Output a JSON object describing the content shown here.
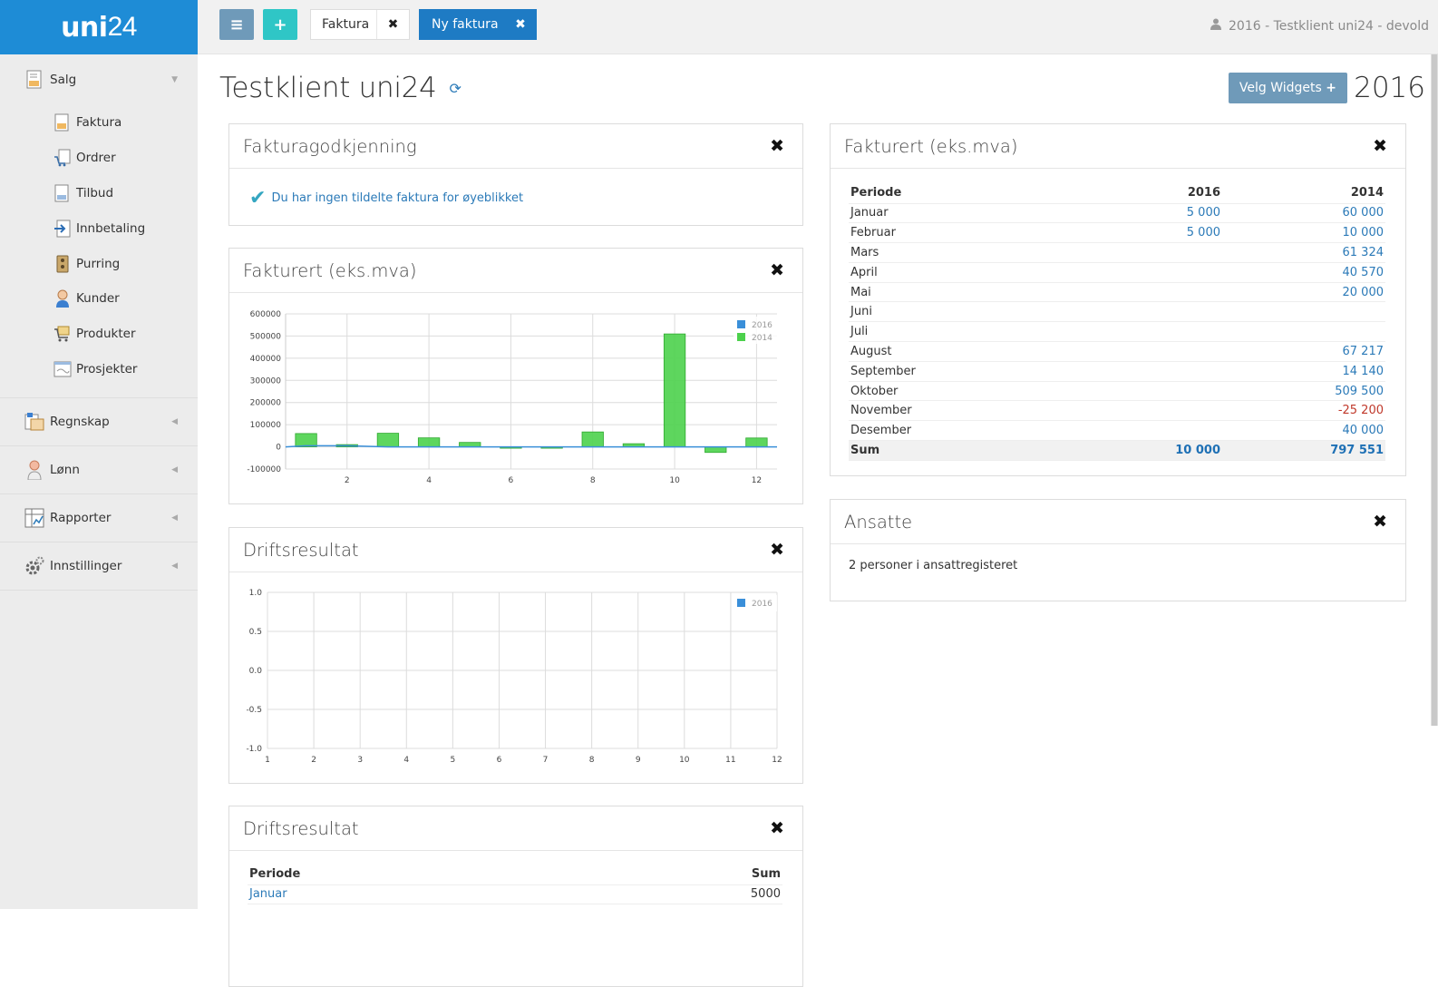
{
  "app": {
    "logo_bold": "uni",
    "logo_num": "24"
  },
  "sidebar": {
    "salg": {
      "label": "Salg"
    },
    "salg_items": [
      {
        "label": "Faktura",
        "icon": "invoice-icon"
      },
      {
        "label": "Ordrer",
        "icon": "order-cart-icon"
      },
      {
        "label": "Tilbud",
        "icon": "quote-icon"
      },
      {
        "label": "Innbetaling",
        "icon": "payment-icon"
      },
      {
        "label": "Purring",
        "icon": "reminder-icon"
      },
      {
        "label": "Kunder",
        "icon": "customer-icon"
      },
      {
        "label": "Produkter",
        "icon": "product-icon"
      },
      {
        "label": "Prosjekter",
        "icon": "project-icon"
      }
    ],
    "sections": [
      {
        "label": "Regnskap",
        "icon": "accounting-icon"
      },
      {
        "label": "Lønn",
        "icon": "salary-person-icon"
      },
      {
        "label": "Rapporter",
        "icon": "report-icon"
      },
      {
        "label": "Innstillinger",
        "icon": "gear-icon"
      }
    ]
  },
  "topbar": {
    "tab1_label": "Faktura",
    "tab2_label": "Ny faktura",
    "user_info": "2016 - Testklient uni24 - devold"
  },
  "main": {
    "title": "Testklient uni24",
    "velg_label": "Velg Widgets",
    "year": "2016"
  },
  "panels": {
    "approval": {
      "title": "Fakturagodkjenning",
      "message": "Du har ingen tildelte faktura for øyeblikket"
    },
    "chart1": {
      "title": "Fakturert (eks.mva)"
    },
    "chart2": {
      "title": "Driftsresultat"
    },
    "drift_table": {
      "title": "Driftsresultat",
      "col_period": "Periode",
      "col_sum": "Sum",
      "rows": [
        {
          "period": "Januar",
          "sum": "5000"
        }
      ]
    },
    "invoiced_table": {
      "title": "Fakturert (eks.mva)",
      "col_period": "Periode",
      "col_2016": "2016",
      "col_2014": "2014",
      "rows": [
        {
          "period": "Januar",
          "v2016": "5 000",
          "v2014": "60 000"
        },
        {
          "period": "Februar",
          "v2016": "5 000",
          "v2014": "10 000"
        },
        {
          "period": "Mars",
          "v2016": "",
          "v2014": "61 324"
        },
        {
          "period": "April",
          "v2016": "",
          "v2014": "40 570"
        },
        {
          "period": "Mai",
          "v2016": "",
          "v2014": "20 000"
        },
        {
          "period": "Juni",
          "v2016": "",
          "v2014": ""
        },
        {
          "period": "Juli",
          "v2016": "",
          "v2014": ""
        },
        {
          "period": "August",
          "v2016": "",
          "v2014": "67 217"
        },
        {
          "period": "September",
          "v2016": "",
          "v2014": "14 140"
        },
        {
          "period": "Oktober",
          "v2016": "",
          "v2014": "509 500"
        },
        {
          "period": "November",
          "v2016": "",
          "v2014": "-25 200"
        },
        {
          "period": "Desember",
          "v2016": "",
          "v2014": "40 000"
        }
      ],
      "sum_label": "Sum",
      "sum_2016": "10 000",
      "sum_2014": "797 551"
    },
    "employees": {
      "title": "Ansatte",
      "text": "2 personer i ansattregisteret"
    }
  },
  "colors": {
    "brand": "#1e8cd6",
    "series_2016": "#3a8fd9",
    "series_2014": "#4cd14c",
    "link": "#2b7ab8",
    "negative": "#c0392b"
  },
  "chart_data": [
    {
      "type": "bar",
      "title": "",
      "x": [
        1,
        2,
        3,
        4,
        5,
        6,
        7,
        8,
        9,
        10,
        11,
        12
      ],
      "xticks": [
        2,
        4,
        6,
        8,
        10,
        12
      ],
      "ylim": [
        -100000,
        600000
      ],
      "yticks": [
        -100000,
        0,
        100000,
        200000,
        300000,
        400000,
        500000,
        600000
      ],
      "legend_position": "top-right",
      "grid": true,
      "series": [
        {
          "name": "2016",
          "type": "line",
          "values": [
            5000,
            5000,
            0,
            0,
            0,
            0,
            0,
            0,
            0,
            0,
            0,
            0
          ]
        },
        {
          "name": "2014",
          "type": "bar",
          "values": [
            60000,
            10000,
            61324,
            40570,
            20000,
            0,
            0,
            67217,
            14140,
            509500,
            -25200,
            40000
          ]
        }
      ]
    },
    {
      "type": "line",
      "title": "",
      "x": [
        1,
        2,
        3,
        4,
        5,
        6,
        7,
        8,
        9,
        10,
        11,
        12
      ],
      "xticks": [
        1,
        2,
        3,
        4,
        5,
        6,
        7,
        8,
        9,
        10,
        11,
        12
      ],
      "ylim": [
        -1.0,
        1.0
      ],
      "yticks": [
        "1.0",
        "0.5",
        "0.0",
        "-0.5",
        "-1.0"
      ],
      "legend_position": "top-right",
      "grid": true,
      "series": [
        {
          "name": "2016",
          "values": []
        }
      ]
    }
  ]
}
